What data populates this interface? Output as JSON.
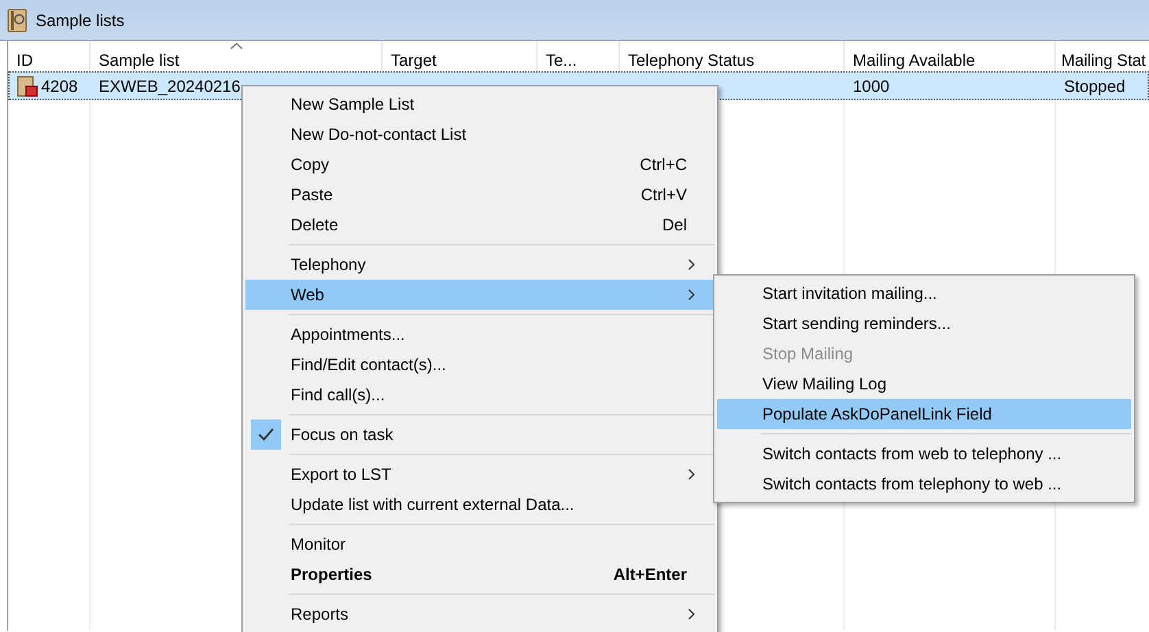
{
  "window": {
    "title": "Sample lists"
  },
  "table": {
    "columns": [
      {
        "label": "ID",
        "sorted": false
      },
      {
        "label": "Sample list",
        "sorted": true
      },
      {
        "label": "Target",
        "sorted": false
      },
      {
        "label": "Te...",
        "sorted": false
      },
      {
        "label": "Telephony Status",
        "sorted": false
      },
      {
        "label": "Mailing Available",
        "sorted": false
      },
      {
        "label": "Mailing Stat",
        "sorted": false
      }
    ],
    "rows": [
      {
        "selected": true,
        "cells": [
          "4208",
          "EXWEB_20240216",
          "",
          "",
          "",
          "1000",
          "Stopped"
        ]
      }
    ]
  },
  "context_menu": {
    "items": [
      {
        "kind": "item",
        "label": "New Sample List",
        "selected": false
      },
      {
        "kind": "item",
        "label": "New Do-not-contact List",
        "selected": false
      },
      {
        "kind": "item",
        "label": "Copy",
        "shortcut": "Ctrl+C",
        "selected": false
      },
      {
        "kind": "item",
        "label": "Paste",
        "shortcut": "Ctrl+V",
        "selected": false
      },
      {
        "kind": "item",
        "label": "Delete",
        "shortcut": "Del",
        "selected": false
      },
      {
        "kind": "separator"
      },
      {
        "kind": "item",
        "label": "Telephony",
        "submenu": true,
        "selected": false
      },
      {
        "kind": "item",
        "label": "Web",
        "submenu": true,
        "selected": true
      },
      {
        "kind": "separator"
      },
      {
        "kind": "item",
        "label": "Appointments...",
        "selected": false
      },
      {
        "kind": "item",
        "label": "Find/Edit contact(s)...",
        "selected": false
      },
      {
        "kind": "item",
        "label": "Find call(s)...",
        "selected": false
      },
      {
        "kind": "separator"
      },
      {
        "kind": "item",
        "label": "Focus on task",
        "checked": true,
        "selected": false
      },
      {
        "kind": "separator"
      },
      {
        "kind": "item",
        "label": "Export to LST",
        "submenu": true,
        "selected": false
      },
      {
        "kind": "item",
        "label": "Update list with current external Data...",
        "selected": false
      },
      {
        "kind": "separator"
      },
      {
        "kind": "item",
        "label": "Monitor",
        "selected": false
      },
      {
        "kind": "item",
        "label": "Properties",
        "shortcut": "Alt+Enter",
        "default": true,
        "selected": false
      },
      {
        "kind": "separator"
      },
      {
        "kind": "item",
        "label": "Reports",
        "submenu": true,
        "selected": false
      }
    ]
  },
  "submenu": {
    "items": [
      {
        "kind": "item",
        "label": "Start invitation mailing...",
        "selected": false
      },
      {
        "kind": "item",
        "label": "Start sending reminders...",
        "selected": false
      },
      {
        "kind": "item",
        "label": "Stop Mailing",
        "disabled": true,
        "selected": false
      },
      {
        "kind": "item",
        "label": "View Mailing Log",
        "selected": false
      },
      {
        "kind": "item",
        "label": "Populate AskDoPanelLink Field",
        "selected": true
      },
      {
        "kind": "separator"
      },
      {
        "kind": "item",
        "label": "Switch contacts from web to telephony ...",
        "selected": false
      },
      {
        "kind": "item",
        "label": "Switch contacts from telephony to web ...",
        "selected": false
      }
    ]
  }
}
